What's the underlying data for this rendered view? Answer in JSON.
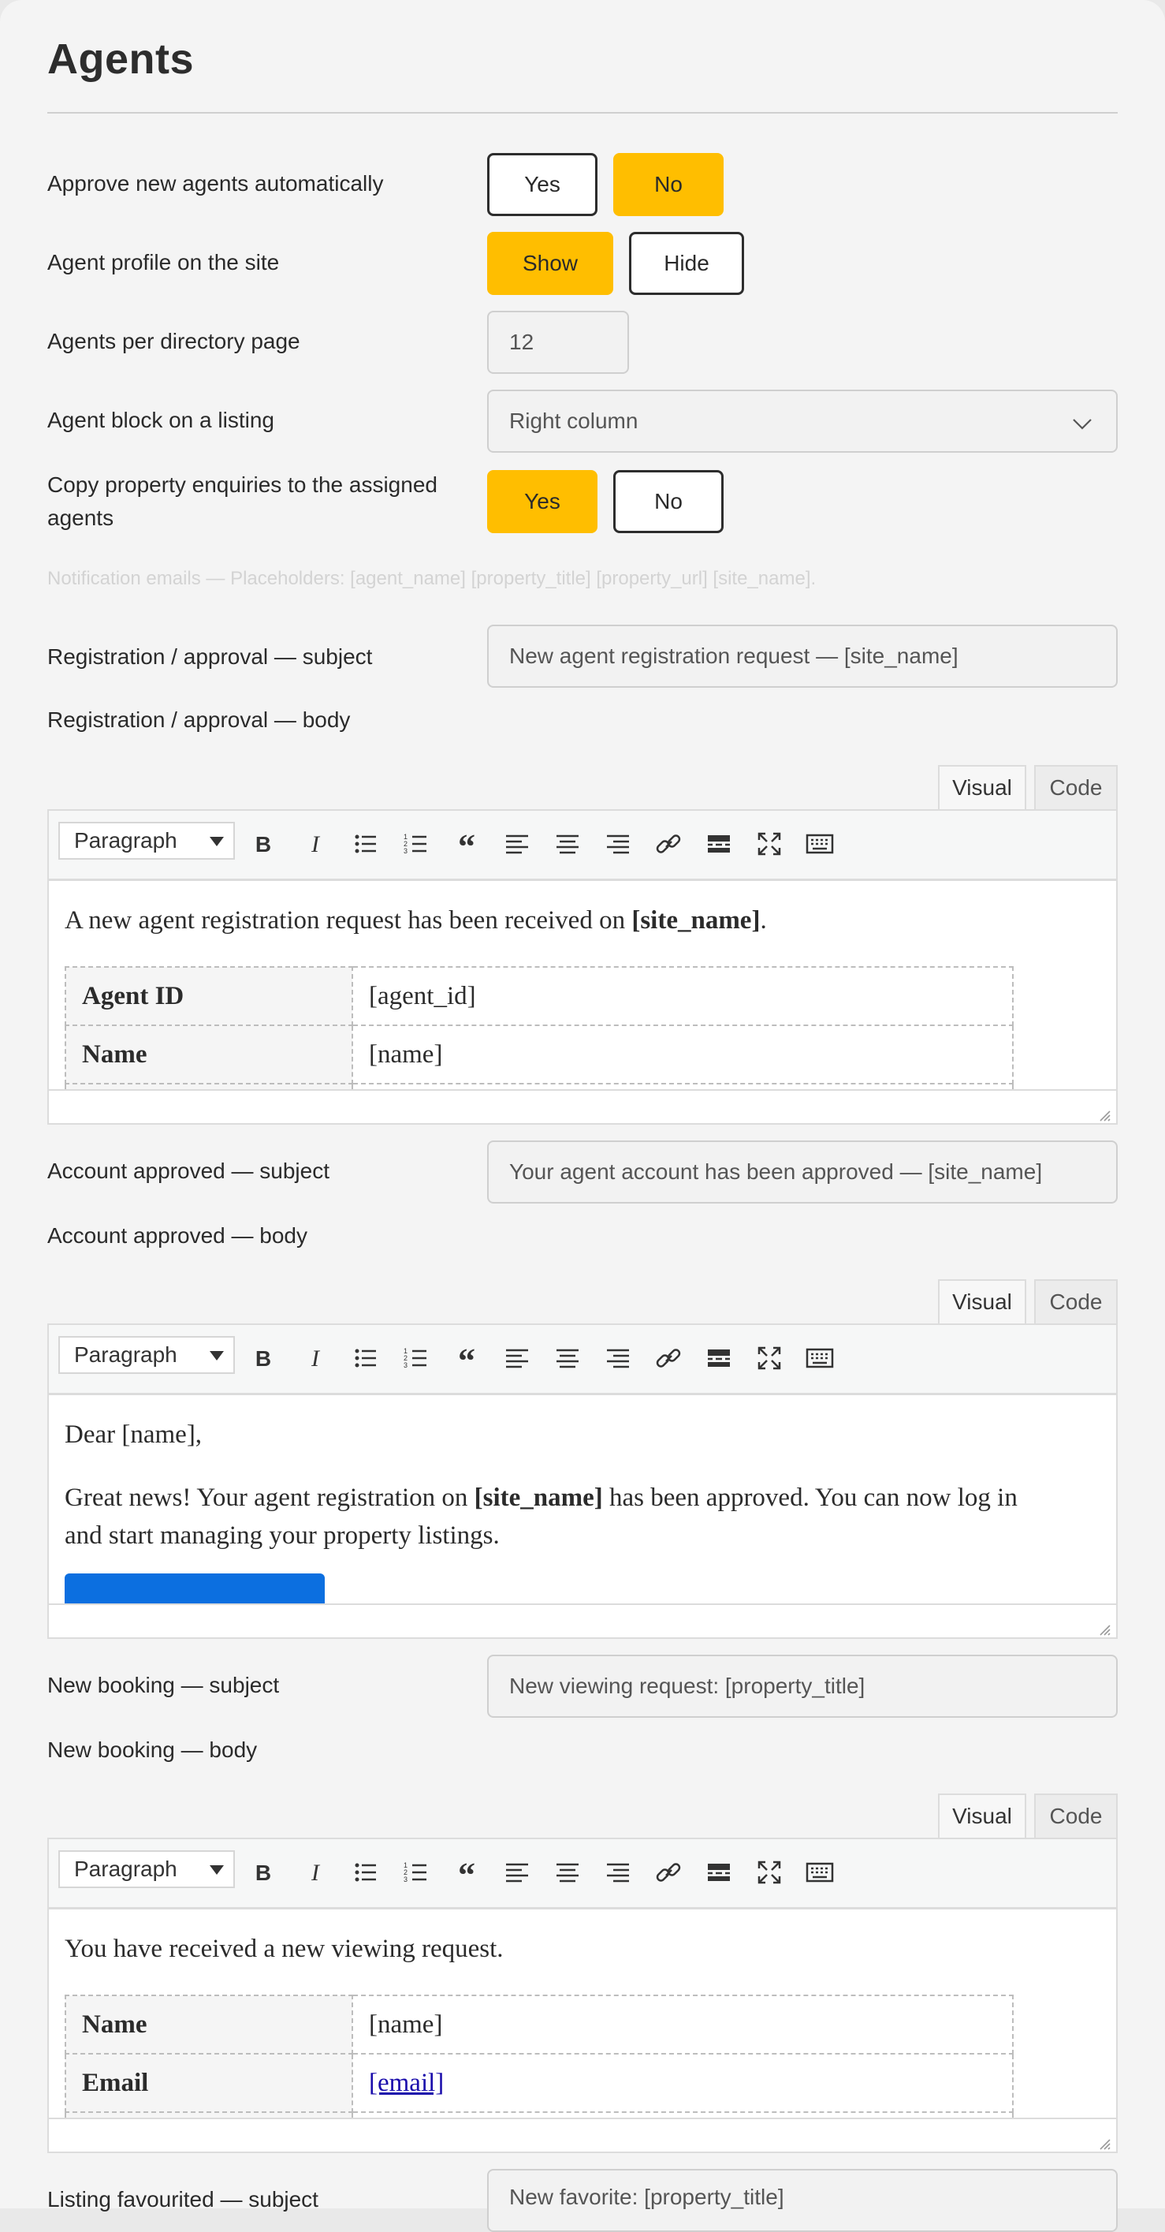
{
  "page": {
    "title": "Agents"
  },
  "settings": {
    "approve": {
      "label": "Approve new agents automatically",
      "yes": "Yes",
      "no": "No",
      "selected": "No"
    },
    "profile": {
      "label": "Agent profile on the site",
      "show": "Show",
      "hide": "Hide",
      "selected": "Show"
    },
    "per_page": {
      "label": "Agents per directory page",
      "value": "12"
    },
    "block": {
      "label": "Agent block on a listing",
      "value": "Right column"
    },
    "copy": {
      "label_line1": "Copy property enquiries to the assigned",
      "label_line2": "agents",
      "yes": "Yes",
      "no": "No",
      "selected": "Yes"
    }
  },
  "hint": "Notification emails — Placeholders: [agent_name] [property_title] [property_url] [site_name].",
  "editor_common": {
    "tab_visual": "Visual",
    "tab_code": "Code",
    "format": "Paragraph"
  },
  "toolbar_icons": [
    "bold-icon",
    "italic-icon",
    "bullet-list-icon",
    "numbered-list-icon",
    "blockquote-icon",
    "align-left-icon",
    "align-center-icon",
    "align-right-icon",
    "link-icon",
    "read-more-icon",
    "fullscreen-icon",
    "keyboard-icon"
  ],
  "registration": {
    "subject_label": "Registration / approval — subject",
    "subject_value": "New agent registration request — [site_name]",
    "body_label": "Registration / approval — body",
    "intro_pre": "A new agent registration request has been received on ",
    "intro_bold": "[site_name]",
    "intro_post": ".",
    "rows": [
      {
        "key": "Agent ID",
        "value": "[agent_id]"
      },
      {
        "key": "Name",
        "value": "[name]"
      }
    ]
  },
  "approved": {
    "subject_label": "Account approved — subject",
    "subject_value": "Your agent account has been approved — [site_name]",
    "body_label": "Account approved — body",
    "greeting": "Dear [name],",
    "msg_pre": "Great news! Your agent registration on ",
    "msg_bold": "[site_name]",
    "msg_post": " has been approved. You can now log in",
    "msg_line2": "and start managing your property listings."
  },
  "booking": {
    "subject_label": "New booking — subject",
    "subject_value": "New viewing request: [property_title]",
    "body_label": "New booking — body",
    "intro": "You have received a new viewing request.",
    "rows": [
      {
        "key": "Name",
        "value": "[name]"
      },
      {
        "key": "Email",
        "value": "[email]"
      }
    ]
  },
  "favourite": {
    "subject_label": "Listing favourited — subject",
    "subject_value": "New favorite: [property_title]"
  },
  "colors": {
    "accent": "#ffbe00",
    "cta": "#0c6fe0",
    "link": "#1a0dab"
  }
}
